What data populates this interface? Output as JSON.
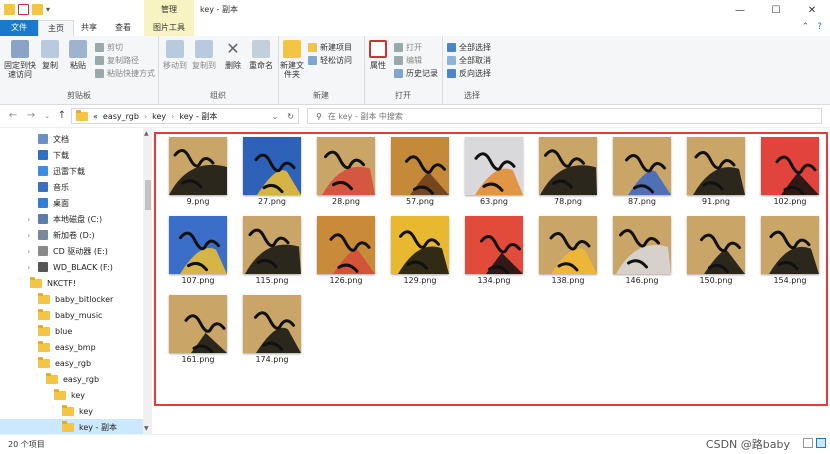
{
  "window": {
    "title": "key - 副本",
    "context_tab": "管理",
    "controls": [
      "—",
      "☐",
      "✕"
    ]
  },
  "tabs": [
    "文件",
    "主页",
    "共享",
    "查看",
    "图片工具"
  ],
  "ribbon": {
    "clipboard": {
      "label": "剪贴板",
      "pin": "固定到快速访问",
      "copy": "复制",
      "paste": "粘贴",
      "cut": "剪切",
      "copy_path": "复制路径",
      "paste_shortcut": "粘贴快捷方式"
    },
    "organize": {
      "label": "组织",
      "move_to": "移动到",
      "copy_to": "复制到",
      "delete": "删除",
      "rename": "重命名"
    },
    "new": {
      "label": "新建",
      "new_folder": "新建文件夹",
      "new_item": "新建项目",
      "easy_access": "轻松访问"
    },
    "open": {
      "label": "打开",
      "properties": "属性",
      "open": "打开",
      "edit": "编辑",
      "history": "历史记录"
    },
    "select": {
      "label": "选择",
      "select_all": "全部选择",
      "select_none": "全部取消",
      "invert": "反向选择"
    }
  },
  "address": {
    "breadcrumb": [
      "«",
      "easy_rgb",
      "key",
      "key - 副本"
    ],
    "search_placeholder": "在 key - 副本 中搜索"
  },
  "nav": [
    {
      "label": "文档",
      "indent": 1
    },
    {
      "label": "下载",
      "indent": 1
    },
    {
      "label": "迅雷下载",
      "indent": 1
    },
    {
      "label": "音乐",
      "indent": 1
    },
    {
      "label": "桌面",
      "indent": 1
    },
    {
      "label": "本地磁盘 (C:)",
      "indent": 1
    },
    {
      "label": "新加卷 (D:)",
      "indent": 1
    },
    {
      "label": "CD 驱动器 (E:)",
      "indent": 1
    },
    {
      "label": "WD_BLACK (F:)",
      "indent": 1
    },
    {
      "label": "NKCTF!",
      "indent": 2
    },
    {
      "label": "baby_bitlocker",
      "indent": 3
    },
    {
      "label": "baby_music",
      "indent": 3
    },
    {
      "label": "blue",
      "indent": 3
    },
    {
      "label": "easy_bmp",
      "indent": 3
    },
    {
      "label": "easy_rgb",
      "indent": 3
    },
    {
      "label": "easy_rgb",
      "indent": 4
    },
    {
      "label": "key",
      "indent": 5
    },
    {
      "label": "key",
      "indent": 6
    },
    {
      "label": "key - 副本",
      "indent": 6
    }
  ],
  "files": [
    "9.png",
    "27.png",
    "28.png",
    "57.png",
    "63.png",
    "78.png",
    "87.png",
    "91.png",
    "102.png",
    "107.png",
    "115.png",
    "126.png",
    "129.png",
    "134.png",
    "138.png",
    "146.png",
    "150.png",
    "154.png",
    "161.png",
    "174.png"
  ],
  "status": {
    "count": "20 个项目",
    "watermark": "CSDN @路baby"
  },
  "colors": {
    "accent": "#1979ca",
    "selection": "#cce8ff",
    "highlight_border": "#e63a3e",
    "thumb_base": "#c9a568"
  }
}
